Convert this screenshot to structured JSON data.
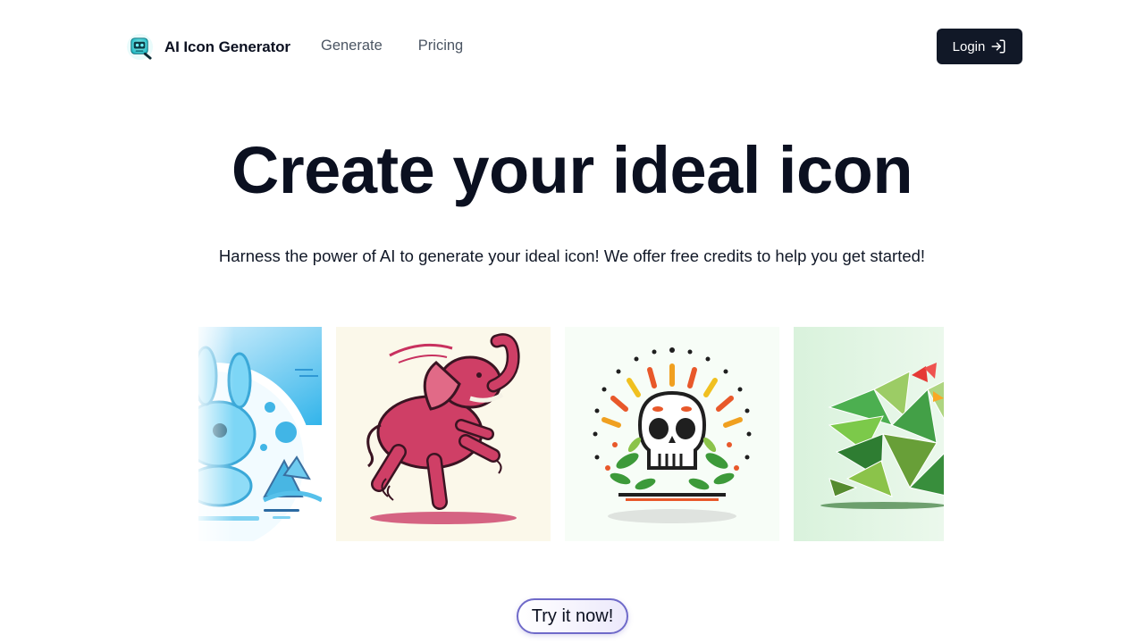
{
  "header": {
    "brand_name": "AI Icon Generator",
    "logo_icon": "robot-logo-icon",
    "nav": [
      {
        "label": "Generate"
      },
      {
        "label": "Pricing"
      }
    ],
    "login_label": "Login",
    "login_icon": "sign-in-arrow-icon"
  },
  "hero": {
    "title": "Create your ideal icon",
    "subtitle": "Harness the power of AI to generate your ideal icon! We offer free credits to help you get started!"
  },
  "gallery": {
    "tiles": [
      {
        "subject": "blue-bunny-snow-illustration"
      },
      {
        "subject": "dancing-pink-elephant-illustration"
      },
      {
        "subject": "floral-sugar-skull-illustration"
      },
      {
        "subject": "green-geometric-rooster-illustration"
      }
    ]
  },
  "cta": {
    "label": "Try it now!"
  },
  "colors": {
    "text": "#0b1020",
    "nav_text": "#4b5563",
    "login_bg": "#111827",
    "cta_border": "#6f6ac9",
    "cta_tint": "#ece9fb"
  }
}
